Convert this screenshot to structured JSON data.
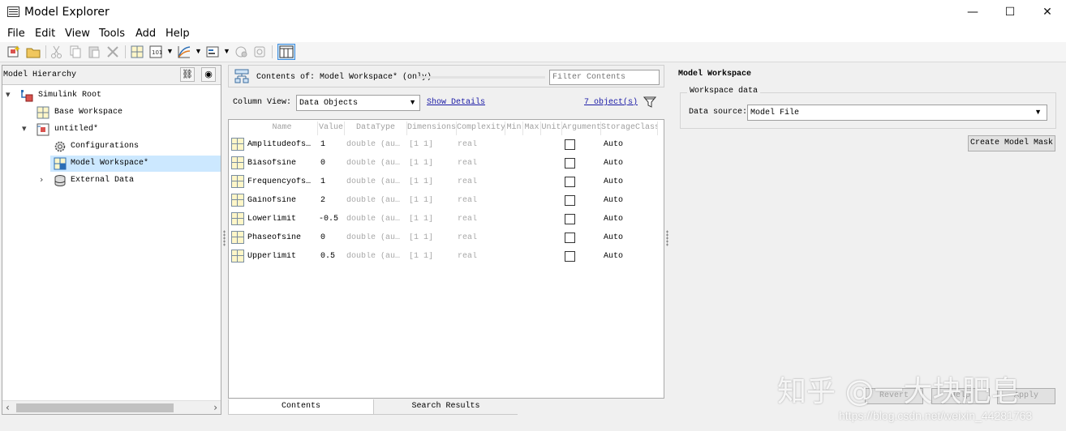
{
  "window": {
    "title": "Model Explorer",
    "controls": [
      "—",
      "☐",
      "✕"
    ]
  },
  "menu": [
    "File",
    "Edit",
    "View",
    "Tools",
    "Add",
    "Help"
  ],
  "hierarchy": {
    "title": "Model Hierarchy",
    "items": [
      {
        "label": "Simulink Root",
        "expander": "▾",
        "icon": "simulink-root-icon"
      },
      {
        "label": "Base Workspace",
        "expander": "",
        "icon": "workspace-grid-icon"
      },
      {
        "label": "untitled*",
        "expander": "▾",
        "icon": "model-icon"
      },
      {
        "label": "Configurations",
        "expander": "",
        "icon": "gear-icon"
      },
      {
        "label": "Model Workspace*",
        "expander": "",
        "icon": "model-workspace-icon",
        "selected": true
      },
      {
        "label": "External Data",
        "expander": "›",
        "icon": "database-icon"
      }
    ]
  },
  "contents": {
    "title": "Contents of: Model Workspace* (only)",
    "filter_placeholder": "Filter Contents",
    "column_view_label": "Column View:",
    "column_view_value": "Data Objects",
    "show_details": "Show Details",
    "object_count": "7 object(s)",
    "columns": [
      "Name",
      "Value",
      "DataType",
      "Dimensions",
      "Complexity",
      "Min",
      "Max",
      "Unit",
      "Argument",
      "StorageClass"
    ],
    "rows": [
      {
        "name": "Amplitudeofs…",
        "value": "1",
        "datatype": "double (au…",
        "dimensions": "[1 1]",
        "complexity": "real",
        "argument": false,
        "storage": "Auto"
      },
      {
        "name": "Biasofsine",
        "value": "0",
        "datatype": "double (au…",
        "dimensions": "[1 1]",
        "complexity": "real",
        "argument": false,
        "storage": "Auto"
      },
      {
        "name": "Frequencyofs…",
        "value": "1",
        "datatype": "double (au…",
        "dimensions": "[1 1]",
        "complexity": "real",
        "argument": false,
        "storage": "Auto"
      },
      {
        "name": "Gainofsine",
        "value": "2",
        "datatype": "double (au…",
        "dimensions": "[1 1]",
        "complexity": "real",
        "argument": false,
        "storage": "Auto"
      },
      {
        "name": "Lowerlimit",
        "value": "-0.5",
        "datatype": "double (au…",
        "dimensions": "[1 1]",
        "complexity": "real",
        "argument": false,
        "storage": "Auto"
      },
      {
        "name": "Phaseofsine",
        "value": "0",
        "datatype": "double (au…",
        "dimensions": "[1 1]",
        "complexity": "real",
        "argument": false,
        "storage": "Auto"
      },
      {
        "name": "Upperlimit",
        "value": "0.5",
        "datatype": "double (au…",
        "dimensions": "[1 1]",
        "complexity": "real",
        "argument": false,
        "storage": "Auto"
      }
    ],
    "tabs": [
      "Contents",
      "Search Results"
    ]
  },
  "workspace_panel": {
    "title": "Model Workspace",
    "group_label": "Workspace data",
    "data_source_label": "Data source:",
    "data_source_value": "Model File",
    "create_mask_button": "Create Model Mask",
    "revert_button": "Revert",
    "help_button": "Help",
    "apply_button": "Apply"
  },
  "watermark": {
    "text": "知乎 @一大块肥皂",
    "url": "https://blog.csdn.net/weixin_44281763"
  }
}
